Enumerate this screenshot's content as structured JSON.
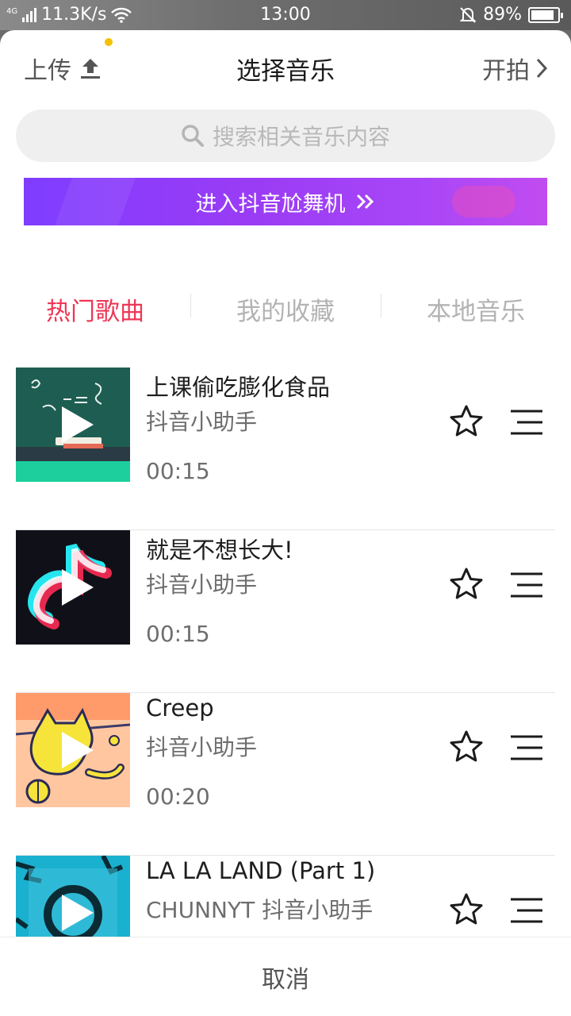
{
  "status_bar": {
    "network": "4G",
    "speed": "11.3K/s",
    "time": "13:00",
    "battery": "89%",
    "battery_level": 0.89
  },
  "header": {
    "upload_label": "上传",
    "title": "选择音乐",
    "start_label": "开拍"
  },
  "search": {
    "placeholder": "搜索相关音乐内容"
  },
  "banner": {
    "label": "进入抖音尬舞机"
  },
  "tabs": [
    {
      "label": "热门歌曲",
      "active": true
    },
    {
      "label": "我的收藏",
      "active": false
    },
    {
      "label": "本地音乐",
      "active": false
    }
  ],
  "songs": [
    {
      "title": "上课偷吃膨化食品",
      "artist": "抖音小助手",
      "duration": "00:15",
      "cover": "chalkboard"
    },
    {
      "title": "就是不想长大!",
      "artist": "抖音小助手",
      "duration": "00:15",
      "cover": "tiktok-logo"
    },
    {
      "title": "Creep",
      "artist": "抖音小助手",
      "duration": "00:20",
      "cover": "yellow-cat"
    },
    {
      "title": "LA LA LAND (Part 1)",
      "artist": "CHUNNYT 抖音小助手",
      "duration": "",
      "cover": "blue-grunge"
    }
  ],
  "footer": {
    "cancel_label": "取消"
  },
  "colors": {
    "accent": "#ee3756",
    "banner": "#9b3cf5",
    "upload_dot": "#f3c100"
  }
}
